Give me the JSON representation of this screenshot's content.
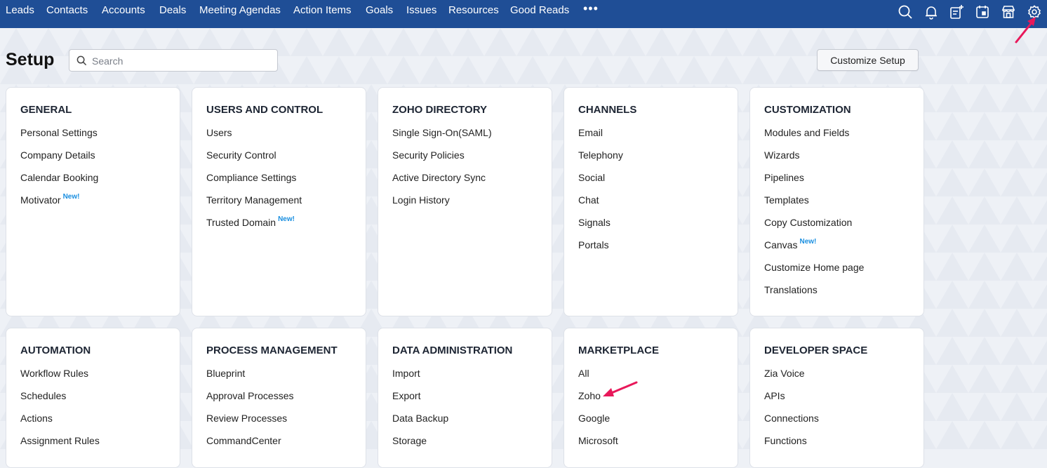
{
  "nav": {
    "items": [
      "Leads",
      "Contacts",
      "Accounts",
      "Deals",
      "Meeting Agendas",
      "Action Items",
      "Goals",
      "Issues",
      "Resources",
      "Good Reads"
    ],
    "more": "•••",
    "icons": [
      "search-icon",
      "bell-icon",
      "add-note-icon",
      "calendar-icon",
      "marketplace-icon",
      "gear-icon"
    ]
  },
  "header": {
    "title": "Setup",
    "search_placeholder": "Search",
    "customize_label": "Customize Setup"
  },
  "new_badge": "New!",
  "cards": [
    {
      "title": "GENERAL",
      "items": [
        {
          "label": "Personal Settings"
        },
        {
          "label": "Company Details"
        },
        {
          "label": "Calendar Booking"
        },
        {
          "label": "Motivator",
          "new": true
        }
      ]
    },
    {
      "title": "USERS AND CONTROL",
      "items": [
        {
          "label": "Users"
        },
        {
          "label": "Security Control"
        },
        {
          "label": "Compliance Settings"
        },
        {
          "label": "Territory Management"
        },
        {
          "label": "Trusted Domain",
          "new": true
        }
      ]
    },
    {
      "title": "ZOHO DIRECTORY",
      "items": [
        {
          "label": "Single Sign-On(SAML)"
        },
        {
          "label": "Security Policies"
        },
        {
          "label": "Active Directory Sync"
        },
        {
          "label": "Login History"
        }
      ]
    },
    {
      "title": "CHANNELS",
      "items": [
        {
          "label": "Email"
        },
        {
          "label": "Telephony"
        },
        {
          "label": "Social"
        },
        {
          "label": "Chat"
        },
        {
          "label": "Signals"
        },
        {
          "label": "Portals"
        }
      ]
    },
    {
      "title": "CUSTOMIZATION",
      "items": [
        {
          "label": "Modules and Fields"
        },
        {
          "label": "Wizards"
        },
        {
          "label": "Pipelines"
        },
        {
          "label": "Templates"
        },
        {
          "label": "Copy Customization"
        },
        {
          "label": "Canvas",
          "new": true
        },
        {
          "label": "Customize Home page"
        },
        {
          "label": "Translations"
        }
      ]
    },
    {
      "title": "AUTOMATION",
      "items": [
        {
          "label": "Workflow Rules"
        },
        {
          "label": "Schedules"
        },
        {
          "label": "Actions"
        },
        {
          "label": "Assignment Rules"
        }
      ]
    },
    {
      "title": "PROCESS MANAGEMENT",
      "items": [
        {
          "label": "Blueprint"
        },
        {
          "label": "Approval Processes"
        },
        {
          "label": "Review Processes"
        },
        {
          "label": "CommandCenter"
        }
      ]
    },
    {
      "title": "DATA ADMINISTRATION",
      "items": [
        {
          "label": "Import"
        },
        {
          "label": "Export"
        },
        {
          "label": "Data Backup"
        },
        {
          "label": "Storage"
        }
      ]
    },
    {
      "title": "MARKETPLACE",
      "items": [
        {
          "label": "All"
        },
        {
          "label": "Zoho"
        },
        {
          "label": "Google"
        },
        {
          "label": "Microsoft"
        }
      ]
    },
    {
      "title": "DEVELOPER SPACE",
      "items": [
        {
          "label": "Zia Voice"
        },
        {
          "label": "APIs"
        },
        {
          "label": "Connections"
        },
        {
          "label": "Functions"
        }
      ]
    }
  ],
  "colors": {
    "nav_bg": "#1f4e96",
    "new_badge": "#1a8fe0",
    "annotation_arrow": "#e8185a"
  }
}
